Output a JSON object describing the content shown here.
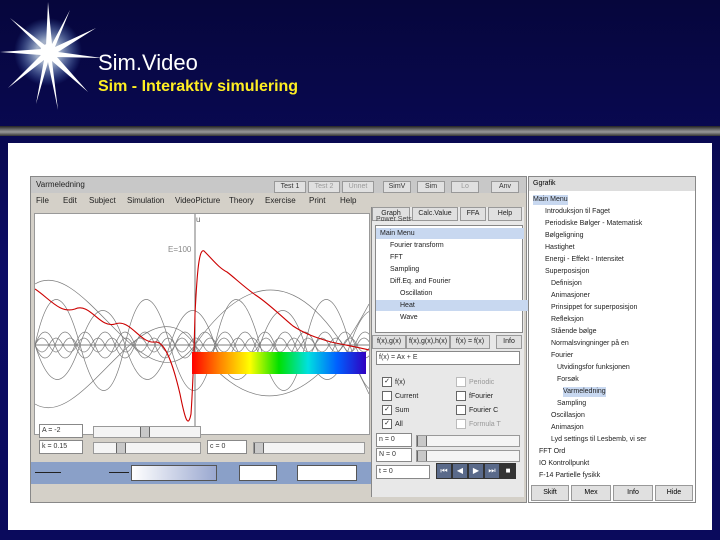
{
  "slide": {
    "title": "Sim.Video",
    "subtitle": "Sim  -  Interaktiv simulering"
  },
  "app": {
    "window_title": "Varmeledning",
    "title_buttons": [
      {
        "label": "Test 1",
        "enabled": true
      },
      {
        "label": "Test 2",
        "enabled": false
      },
      {
        "label": "Unnet",
        "enabled": false
      },
      {
        "label": "SimV",
        "enabled": true
      },
      {
        "label": "Sim",
        "enabled": true
      },
      {
        "label": "Lo",
        "enabled": false
      },
      {
        "label": "Anv",
        "enabled": true
      }
    ],
    "menu": [
      "File",
      "Edit",
      "Subject",
      "Simulation",
      "VideoPicture",
      "Theory",
      "Exercise",
      "Print",
      "Help"
    ],
    "toolbar_right": [
      "Graph",
      "Calc.Value",
      "FFA",
      "Help"
    ],
    "plot": {
      "axis_label_u": "u",
      "energy_label": "E=100"
    },
    "params": {
      "a_label": "A = -2",
      "k_label": "k = 0.15",
      "c_label": "c = 0"
    }
  },
  "right_pane": {
    "tree_header": "Power Sets",
    "tree": [
      {
        "text": "Main Menu",
        "indent": 0,
        "selected": true
      },
      {
        "text": "Fourier transform",
        "indent": 1,
        "selected": false
      },
      {
        "text": "FFT",
        "indent": 1,
        "selected": false
      },
      {
        "text": "Sampling",
        "indent": 1,
        "selected": false
      },
      {
        "text": "Diff.Eq. and Fourier",
        "indent": 1,
        "selected": false
      },
      {
        "text": "Oscillation",
        "indent": 2,
        "selected": false
      },
      {
        "text": "Heat",
        "indent": 2,
        "selected": true
      },
      {
        "text": "Wave",
        "indent": 2,
        "selected": false
      }
    ],
    "formula_tabs": [
      "f(x),g(x)",
      "f(x),g(x),h(x)",
      "f(x) = f(x)",
      "Info"
    ],
    "formula": "f(x) = Ax + E",
    "checkboxes": [
      {
        "label": "f(x)",
        "checked": true,
        "enabled": true
      },
      {
        "label": "Periodic",
        "checked": false,
        "enabled": false
      },
      {
        "label": "Current",
        "checked": false,
        "enabled": true
      },
      {
        "label": "fFourier",
        "checked": false,
        "enabled": true
      },
      {
        "label": "Sum",
        "checked": true,
        "enabled": true
      },
      {
        "label": "Fourier C",
        "checked": false,
        "enabled": true
      },
      {
        "label": "All",
        "checked": true,
        "enabled": true
      },
      {
        "label": "Formula T",
        "checked": false,
        "enabled": false
      }
    ],
    "n_label": "n = 0",
    "n2_label": "N = 0",
    "t_label": "t = 0"
  },
  "graph_panel": {
    "title": "Ggrafik",
    "items": [
      {
        "text": "Main Menu",
        "indent": 0,
        "selected": true
      },
      {
        "text": "Introduksjon til Faget",
        "indent": 2,
        "selected": false
      },
      {
        "text": "Periodiske Bølger - Matematisk",
        "indent": 2,
        "selected": false
      },
      {
        "text": "Bølgeligning",
        "indent": 2,
        "selected": false
      },
      {
        "text": "Hastighet",
        "indent": 2,
        "selected": false
      },
      {
        "text": "Energi - Effekt - Intensitet",
        "indent": 2,
        "selected": false
      },
      {
        "text": "Superposisjon",
        "indent": 2,
        "selected": false
      },
      {
        "text": "Definisjon",
        "indent": 3,
        "selected": false
      },
      {
        "text": "Animasjoner",
        "indent": 3,
        "selected": false
      },
      {
        "text": "Prinsippet for superposisjon",
        "indent": 3,
        "selected": false
      },
      {
        "text": "Refleksjon",
        "indent": 3,
        "selected": false
      },
      {
        "text": "Stående bølge",
        "indent": 3,
        "selected": false
      },
      {
        "text": "Normalsvingninger på en",
        "indent": 3,
        "selected": false
      },
      {
        "text": "Fourier",
        "indent": 3,
        "selected": false
      },
      {
        "text": "Utvidingsfor funksjonen",
        "indent": 4,
        "selected": false
      },
      {
        "text": "Forsøk",
        "indent": 4,
        "selected": false
      },
      {
        "text": "Varmeledning",
        "indent": 5,
        "selected": true
      },
      {
        "text": "Sampling",
        "indent": 4,
        "selected": false
      },
      {
        "text": "Oscillasjon",
        "indent": 3,
        "selected": false
      },
      {
        "text": "Animasjon",
        "indent": 3,
        "selected": false
      },
      {
        "text": "Lyd settings til Lesbemb, vi ser",
        "indent": 3,
        "selected": false
      },
      {
        "text": "FFT Ord",
        "indent": 1,
        "selected": false
      },
      {
        "text": "IO Kontrollpunkt",
        "indent": 1,
        "selected": false
      },
      {
        "text": "F-14 Partielle fysikk",
        "indent": 1,
        "selected": false
      }
    ],
    "buttons": [
      "Skift",
      "Mex",
      "Info",
      "Hide"
    ]
  }
}
